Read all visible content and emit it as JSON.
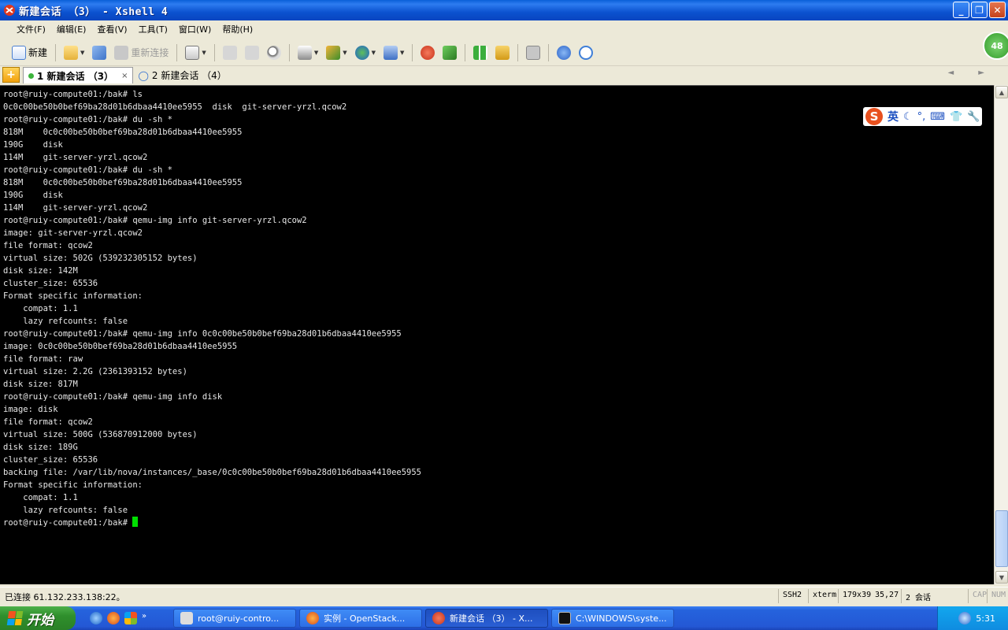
{
  "window": {
    "title": "新建会话 （3） - Xshell 4",
    "buttons": {
      "minimize": "_",
      "maximize": "❐",
      "close": "✕"
    }
  },
  "menu": [
    "文件(F)",
    "编辑(E)",
    "查看(V)",
    "工具(T)",
    "窗口(W)",
    "帮助(H)"
  ],
  "toolbar": {
    "new_label": "新建",
    "reconnect_label": "重新连接",
    "badge": "48"
  },
  "tabs": [
    {
      "label": "1 新建会话 （3）",
      "active": true,
      "close": "×"
    },
    {
      "label": "2 新建会话 （4）",
      "active": false
    }
  ],
  "tab_nav": "◄ ►",
  "ime": {
    "lang": "英",
    "logo": "S"
  },
  "terminal": {
    "lines": [
      "root@ruiy-compute01:/bak# ls",
      "0c0c00be50b0bef69ba28d01b6dbaa4410ee5955  disk  git-server-yrzl.qcow2",
      "root@ruiy-compute01:/bak# du -sh *",
      "818M    0c0c00be50b0bef69ba28d01b6dbaa4410ee5955",
      "190G    disk",
      "114M    git-server-yrzl.qcow2",
      "root@ruiy-compute01:/bak# du -sh *",
      "818M    0c0c00be50b0bef69ba28d01b6dbaa4410ee5955",
      "190G    disk",
      "114M    git-server-yrzl.qcow2",
      "root@ruiy-compute01:/bak# qemu-img info git-server-yrzl.qcow2",
      "image: git-server-yrzl.qcow2",
      "file format: qcow2",
      "virtual size: 502G (539232305152 bytes)",
      "disk size: 142M",
      "cluster_size: 65536",
      "Format specific information:",
      "    compat: 1.1",
      "    lazy refcounts: false",
      "root@ruiy-compute01:/bak# qemu-img info 0c0c00be50b0bef69ba28d01b6dbaa4410ee5955",
      "image: 0c0c00be50b0bef69ba28d01b6dbaa4410ee5955",
      "file format: raw",
      "virtual size: 2.2G (2361393152 bytes)",
      "disk size: 817M",
      "root@ruiy-compute01:/bak# qemu-img info disk",
      "image: disk",
      "file format: qcow2",
      "virtual size: 500G (536870912000 bytes)",
      "disk size: 189G",
      "cluster_size: 65536",
      "backing file: /var/lib/nova/instances/_base/0c0c00be50b0bef69ba28d01b6dbaa4410ee5955",
      "Format specific information:",
      "    compat: 1.1",
      "    lazy refcounts: false"
    ],
    "prompt": "root@ruiy-compute01:/bak# "
  },
  "status": {
    "connection": "已连接 61.132.233.138:22。",
    "protocol": "SSH2",
    "term_type": "xterm",
    "size": "179x39",
    "cursor_pos": "35,27",
    "sessions": "2 会话",
    "caps": "CAP",
    "num": "NUM"
  },
  "taskbar": {
    "start_label": "开始",
    "tasks": [
      {
        "label": "root@ruiy-contro...",
        "active": false
      },
      {
        "label": "实例 - OpenStack...",
        "active": false
      },
      {
        "label": "新建会话 （3） - X...",
        "active": true
      },
      {
        "label": "C:\\WINDOWS\\syste...",
        "active": false
      }
    ],
    "clock": "5:31"
  },
  "colors": {
    "terminal_bg": "#000000",
    "terminal_fg": "#e8e8e8",
    "cursor": "#00e000",
    "title_blue": "#0b52cf"
  }
}
